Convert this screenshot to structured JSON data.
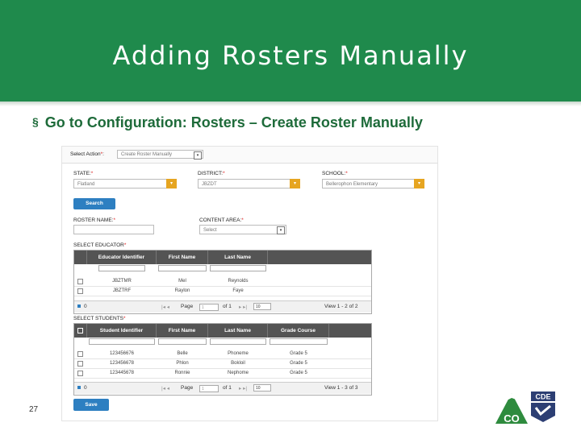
{
  "slide": {
    "title": "Adding Rosters Manually",
    "bullet": "Go to Configuration: Rosters – Create Roster Manually",
    "bullet_marker": "§",
    "number": "27"
  },
  "form": {
    "select_action_label": "Select Action",
    "select_action_value": "Create Roster Manually",
    "state_label": "STATE:",
    "state_value": "Flatland",
    "district_label": "DISTRICT:",
    "district_value": "JBZDT",
    "school_label": "SCHOOL:",
    "school_value": "Bellerophon Elementary",
    "search_button": "Search",
    "roster_name_label": "ROSTER NAME:",
    "content_area_label": "CONTENT AREA:",
    "content_area_value": "Select",
    "required_mark": "*",
    "save_button": "Save"
  },
  "educators": {
    "section_label": "SELECT EDUCATOR",
    "columns": [
      "Educator Identifier",
      "First Name",
      "Last Name"
    ],
    "rows": [
      {
        "id": "JBZTMR",
        "first": "Mel",
        "last": "Reynolds"
      },
      {
        "id": "JBZTRF",
        "first": "Raylon",
        "last": "Faye"
      }
    ],
    "pager": {
      "selected": "0",
      "page_label": "Page",
      "page_value": "1",
      "of_label": "of 1",
      "per_page": "10",
      "view": "View 1 - 2 of 2"
    }
  },
  "students": {
    "section_label": "SELECT STUDENTS",
    "columns": [
      "Student Identifier",
      "First Name",
      "Last Name",
      "Grade Course"
    ],
    "rows": [
      {
        "id": "123456676",
        "first": "Belle",
        "last": "Phoneme",
        "grade": "Grade 5"
      },
      {
        "id": "123456678",
        "first": "Phlon",
        "last": "Bokloil",
        "grade": "Grade 5"
      },
      {
        "id": "123445678",
        "first": "Ronnie",
        "last": "Nephome",
        "grade": "Grade 5"
      }
    ],
    "pager": {
      "selected": "0",
      "page_label": "Page",
      "page_value": "1",
      "of_label": "of 1",
      "per_page": "10",
      "view": "View 1 - 3 of 3"
    }
  },
  "logo": {
    "text_top": "CDE",
    "text_main": "CO"
  },
  "colors": {
    "header_green": "#1f8a4c",
    "bullet_green": "#1e6b3a",
    "button_blue": "#2d7fc1",
    "dropdown_orange": "#e6a521",
    "grid_header": "#545454"
  }
}
